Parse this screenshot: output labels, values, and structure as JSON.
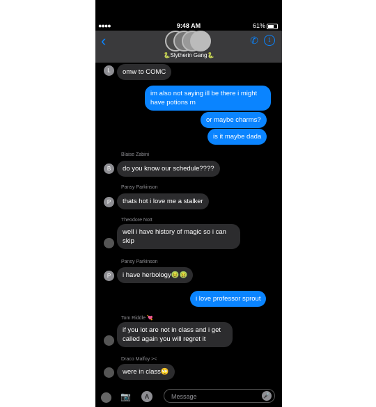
{
  "status": {
    "signal": "●●●●",
    "time": "9:48 AM",
    "battery": "61%"
  },
  "header": {
    "group_name": "🐍Slytherin Gang🐍"
  },
  "messages": [
    {
      "kind": "in",
      "text": "omw to COMC",
      "initial": "L"
    },
    {
      "kind": "out",
      "text": "im also not saying ill be there i might have potions rn"
    },
    {
      "kind": "out",
      "text": "or maybe charms?"
    },
    {
      "kind": "out",
      "text": "is it maybe dada"
    },
    {
      "kind": "sender",
      "text": "Blaise Zabini"
    },
    {
      "kind": "in",
      "text": "do you know our schedule????",
      "initial": "B"
    },
    {
      "kind": "sender",
      "text": "Pansy Parkinson"
    },
    {
      "kind": "in",
      "text": "thats hot i love me a stalker",
      "initial": "P"
    },
    {
      "kind": "sender",
      "text": "Theodore Nott"
    },
    {
      "kind": "in",
      "text": "well i have history of magic so i can skip"
    },
    {
      "kind": "sender",
      "text": "Pansy Parkinson"
    },
    {
      "kind": "in",
      "text": "i have herbology🤢🤢",
      "initial": "P"
    },
    {
      "kind": "out",
      "text": "i love professor sprout"
    },
    {
      "kind": "sender",
      "text": "Tom Riddle 💘"
    },
    {
      "kind": "in",
      "text": "if you lot are not in class and i get called again you will regret it"
    },
    {
      "kind": "sender",
      "text": "Draco Malfoy ><"
    },
    {
      "kind": "in",
      "text": "were in class🙄"
    }
  ],
  "input": {
    "placeholder": "Message"
  },
  "colors": {
    "accent": "#0a84ff",
    "incoming": "#2c2c2e",
    "header": "#3a3a3c"
  }
}
